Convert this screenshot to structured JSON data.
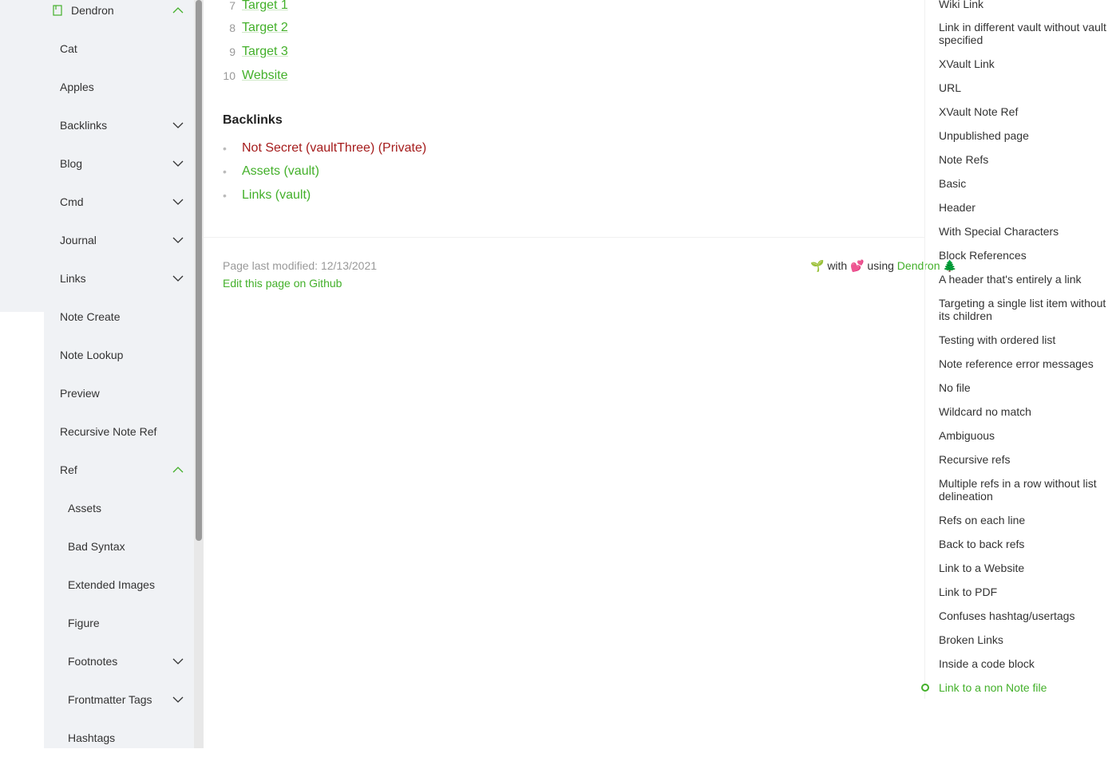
{
  "sidebar": {
    "root": {
      "label": "Dendron"
    },
    "items": [
      {
        "label": "Cat"
      },
      {
        "label": "Apples"
      },
      {
        "label": "Backlinks"
      },
      {
        "label": "Blog"
      },
      {
        "label": "Cmd"
      },
      {
        "label": "Journal"
      },
      {
        "label": "Links"
      },
      {
        "label": "Note Create"
      },
      {
        "label": "Note Lookup"
      },
      {
        "label": "Preview"
      },
      {
        "label": "Recursive Note Ref"
      },
      {
        "label": "Ref"
      }
    ],
    "sub_items": [
      {
        "label": "Assets"
      },
      {
        "label": "Bad Syntax"
      },
      {
        "label": "Extended Images"
      },
      {
        "label": "Figure"
      },
      {
        "label": "Footnotes"
      },
      {
        "label": "Frontmatter Tags"
      },
      {
        "label": "Hashtags"
      }
    ]
  },
  "main": {
    "ordered_list": [
      {
        "num": "7",
        "label": "Target 1"
      },
      {
        "num": "8",
        "label": "Target 2"
      },
      {
        "num": "9",
        "label": "Target 3"
      },
      {
        "num": "10",
        "label": "Website"
      }
    ],
    "backlinks_title": "Backlinks",
    "backlinks": [
      {
        "label": "Not Secret (vaultThree) (Private)"
      },
      {
        "label": "Assets (vault)"
      },
      {
        "label": "Links (vault)"
      }
    ],
    "footer": {
      "modified": "Page last modified: 12/13/2021",
      "edit": "Edit this page on Github",
      "made_prefix": "🌱 with 💕 using ",
      "made_link": "Dendron",
      "made_suffix": " 🌲"
    }
  },
  "toc": {
    "items": [
      {
        "label": "Wiki Link"
      },
      {
        "label": "Link in different vault without vault specified"
      },
      {
        "label": "XVault Link"
      },
      {
        "label": "URL"
      },
      {
        "label": "XVault Note Ref"
      },
      {
        "label": "Unpublished page"
      },
      {
        "label": "Note Refs"
      },
      {
        "label": "Basic"
      },
      {
        "label": "Header"
      },
      {
        "label": "With Special Characters"
      },
      {
        "label": "Block References"
      },
      {
        "label": "A header that's entirely a link"
      },
      {
        "label": "Targeting a single list item without its children"
      },
      {
        "label": "Testing with ordered list"
      },
      {
        "label": "Note reference error messages"
      },
      {
        "label": "No file"
      },
      {
        "label": "Wildcard no match"
      },
      {
        "label": "Ambiguous"
      },
      {
        "label": "Recursive refs"
      },
      {
        "label": "Multiple refs in a row without list delineation"
      },
      {
        "label": "Refs on each line"
      },
      {
        "label": "Back to back refs"
      },
      {
        "label": "Link to a Website"
      },
      {
        "label": "Link to PDF"
      },
      {
        "label": "Confuses hashtag/usertags"
      },
      {
        "label": "Broken Links"
      },
      {
        "label": "Inside a code block"
      },
      {
        "label": "Link to a non Note file"
      }
    ]
  },
  "colors": {
    "accent": "#43b02a",
    "private": "#a51c1c"
  }
}
